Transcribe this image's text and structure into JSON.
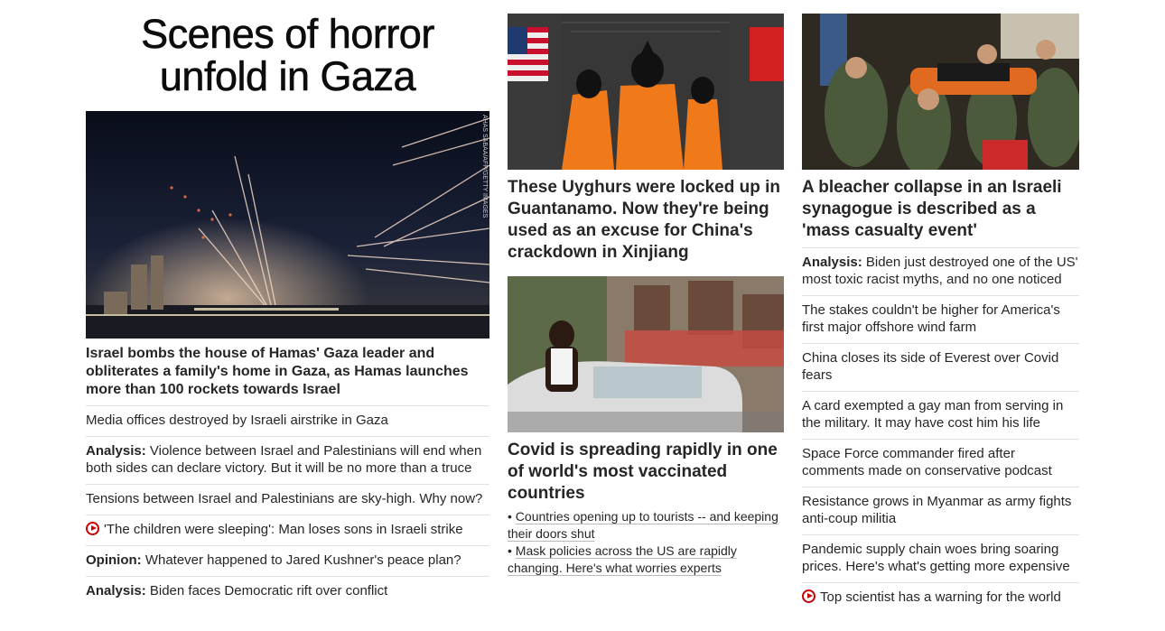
{
  "banner": {
    "title": "Scenes of horror unfold in Gaza"
  },
  "col1": {
    "image": {
      "credit": "AHAS SABAA/AFP/GETTY IMAGES",
      "icon": "rocket-night-photo"
    },
    "headline": "Israel bombs the house of Hamas' Gaza leader and obliterates a family's home in Gaza, as Hamas launches more than 100 rockets towards Israel",
    "links": [
      {
        "prefix": "",
        "text": "Media offices destroyed by Israeli airstrike in Gaza",
        "video": false
      },
      {
        "prefix": "Analysis:",
        "text": "Violence between Israel and Palestinians will end when both sides can declare victory. But it will be no more than a truce",
        "video": false
      },
      {
        "prefix": "",
        "text": "Tensions between Israel and Palestinians are sky-high. Why now?",
        "video": false
      },
      {
        "prefix": "",
        "text": "'The children were sleeping': Man loses sons in Israeli strike",
        "video": true
      },
      {
        "prefix": "Opinion:",
        "text": "Whatever happened to Jared Kushner's peace plan?",
        "video": false
      },
      {
        "prefix": "Analysis:",
        "text": "Biden faces Democratic rift over conflict",
        "video": false
      }
    ]
  },
  "col2": {
    "story1": {
      "headline": "These Uyghurs were locked up in Guantanamo. Now they're being used as an excuse for China's crackdown in Xinjiang"
    },
    "story2": {
      "headline": "Covid is spreading rapidly in one of world's most vaccinated countries",
      "bullets": [
        "Countries opening up to tourists -- and keeping their doors shut",
        "Mask policies across the US are rapidly changing. Here's what worries experts"
      ]
    }
  },
  "col3": {
    "headline": "A bleacher collapse in an Israeli synagogue is described as a 'mass casualty event'",
    "links": [
      {
        "prefix": "Analysis:",
        "text": "Biden just destroyed one of the US' most toxic racist myths, and no one noticed",
        "video": false
      },
      {
        "prefix": "",
        "text": "The stakes couldn't be higher for America's first major offshore wind farm",
        "video": false
      },
      {
        "prefix": "",
        "text": "China closes its side of Everest over Covid fears",
        "video": false
      },
      {
        "prefix": "",
        "text": "A card exempted a gay man from serving in the military. It may have cost him his life",
        "video": false
      },
      {
        "prefix": "",
        "text": "Space Force commander fired after comments made on conservative podcast",
        "video": false
      },
      {
        "prefix": "",
        "text": "Resistance grows in Myanmar as army fights anti-coup militia",
        "video": false
      },
      {
        "prefix": "",
        "text": "Pandemic supply chain woes bring soaring prices. Here's what's getting more expensive",
        "video": false
      },
      {
        "prefix": "",
        "text": "Top scientist has a warning for the world",
        "video": true
      }
    ]
  },
  "colors": {
    "text": "#262626",
    "divider": "#e1e1e1",
    "video": "#cc0000"
  }
}
